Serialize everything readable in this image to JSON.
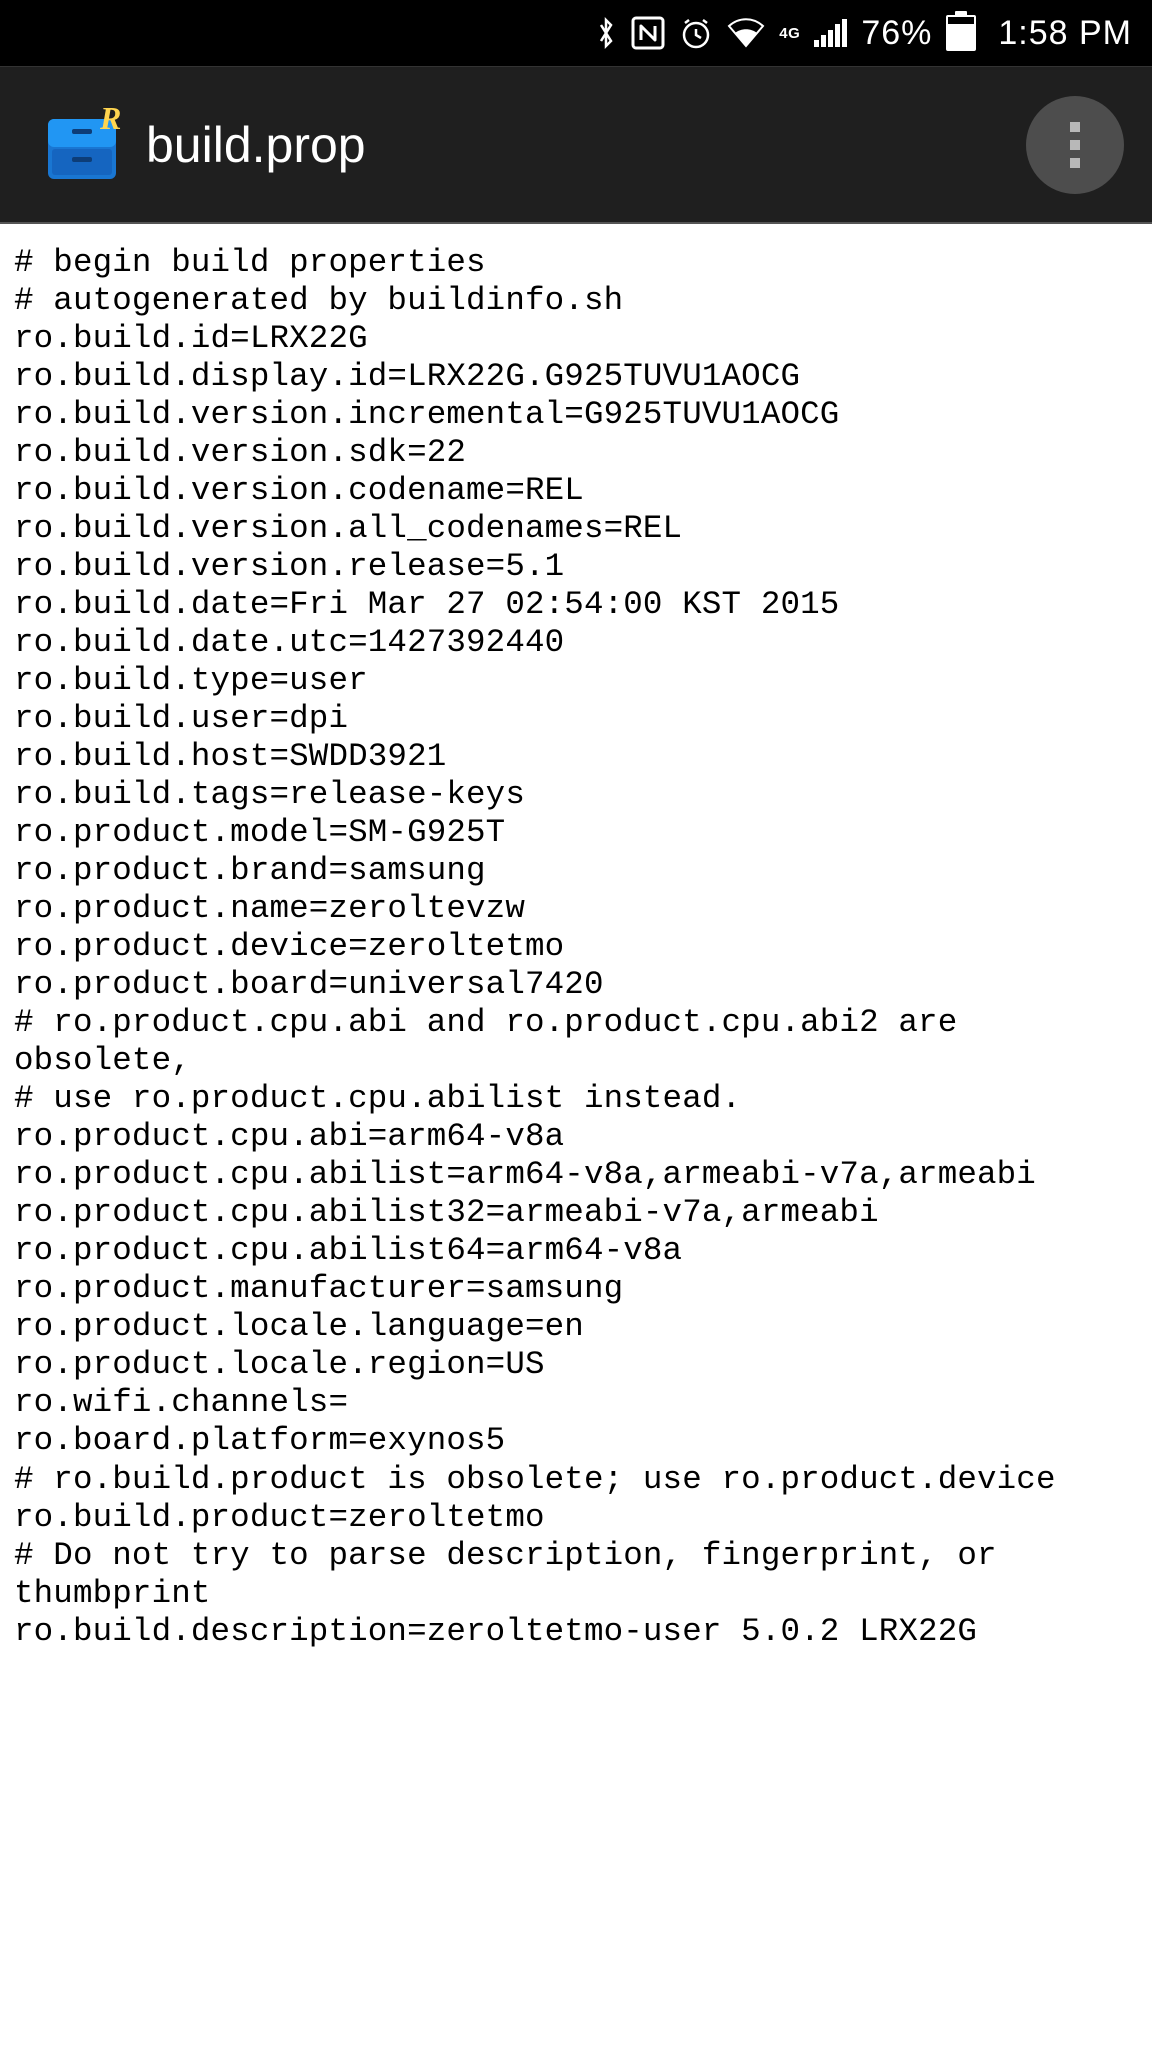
{
  "status_bar": {
    "battery_percent": "76%",
    "time": "1:58 PM",
    "network_label": "4G"
  },
  "app_bar": {
    "title": "build.prop"
  },
  "file_content": "# begin build properties\n# autogenerated by buildinfo.sh\nro.build.id=LRX22G\nro.build.display.id=LRX22G.G925TUVU1AOCG\nro.build.version.incremental=G925TUVU1AOCG\nro.build.version.sdk=22\nro.build.version.codename=REL\nro.build.version.all_codenames=REL\nro.build.version.release=5.1\nro.build.date=Fri Mar 27 02:54:00 KST 2015\nro.build.date.utc=1427392440\nro.build.type=user\nro.build.user=dpi\nro.build.host=SWDD3921\nro.build.tags=release-keys\nro.product.model=SM-G925T\nro.product.brand=samsung\nro.product.name=zeroltevzw\nro.product.device=zeroltetmo\nro.product.board=universal7420\n# ro.product.cpu.abi and ro.product.cpu.abi2 are obsolete,\n# use ro.product.cpu.abilist instead.\nro.product.cpu.abi=arm64-v8a\nro.product.cpu.abilist=arm64-v8a,armeabi-v7a,armeabi\nro.product.cpu.abilist32=armeabi-v7a,armeabi\nro.product.cpu.abilist64=arm64-v8a\nro.product.manufacturer=samsung\nro.product.locale.language=en\nro.product.locale.region=US\nro.wifi.channels=\nro.board.platform=exynos5\n# ro.build.product is obsolete; use ro.product.device\nro.build.product=zeroltetmo\n# Do not try to parse description, fingerprint, or thumbprint\nro.build.description=zeroltetmo-user 5.0.2 LRX22G"
}
